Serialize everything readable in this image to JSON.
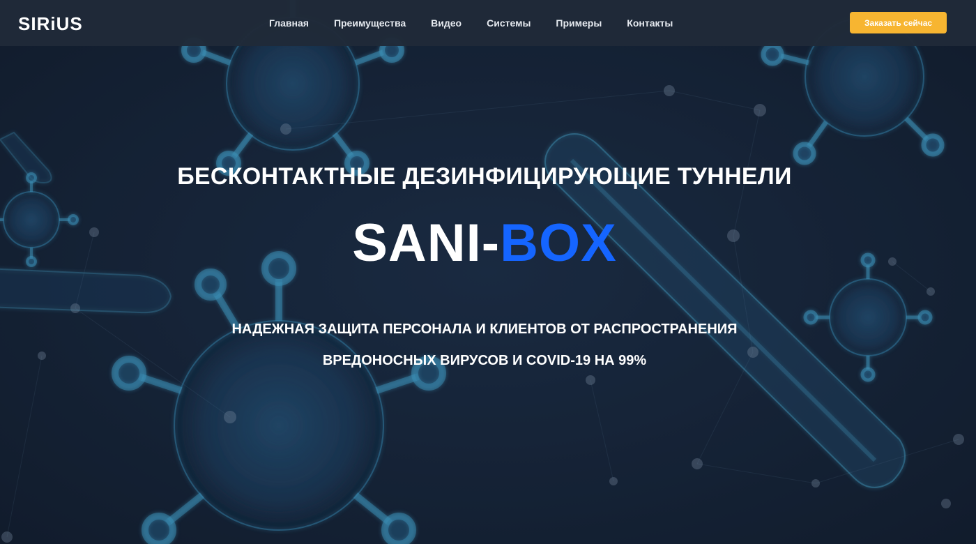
{
  "brand": {
    "logo_text": "SIRiUS"
  },
  "nav": {
    "items": [
      "Главная",
      "Преимущества",
      "Видео",
      "Системы",
      "Примеры",
      "Контакты"
    ]
  },
  "cta": {
    "label": "Заказать сейчас"
  },
  "hero": {
    "tagline": "БЕСКОНТАКТНЫЕ ДЕЗИНФИЦИРУЮЩИЕ ТУННЕЛИ",
    "title_part1": "SANI-",
    "title_part2": "BOX",
    "subtitle_line1": "НАДЕЖНАЯ ЗАЩИТА ПЕРСОНАЛА И КЛИЕНТОВ ОТ РАСПРОСТРАНЕНИЯ",
    "subtitle_line2": "ВРЕДОНОСНЫХ ВИРУСОВ И COVID-19 НА 99%"
  },
  "colors": {
    "nav_bg": "#202a39",
    "hero_bg": "#18263a",
    "accent_orange": "#f7b531",
    "accent_blue": "#1565ff",
    "text_white": "#ffffff"
  }
}
